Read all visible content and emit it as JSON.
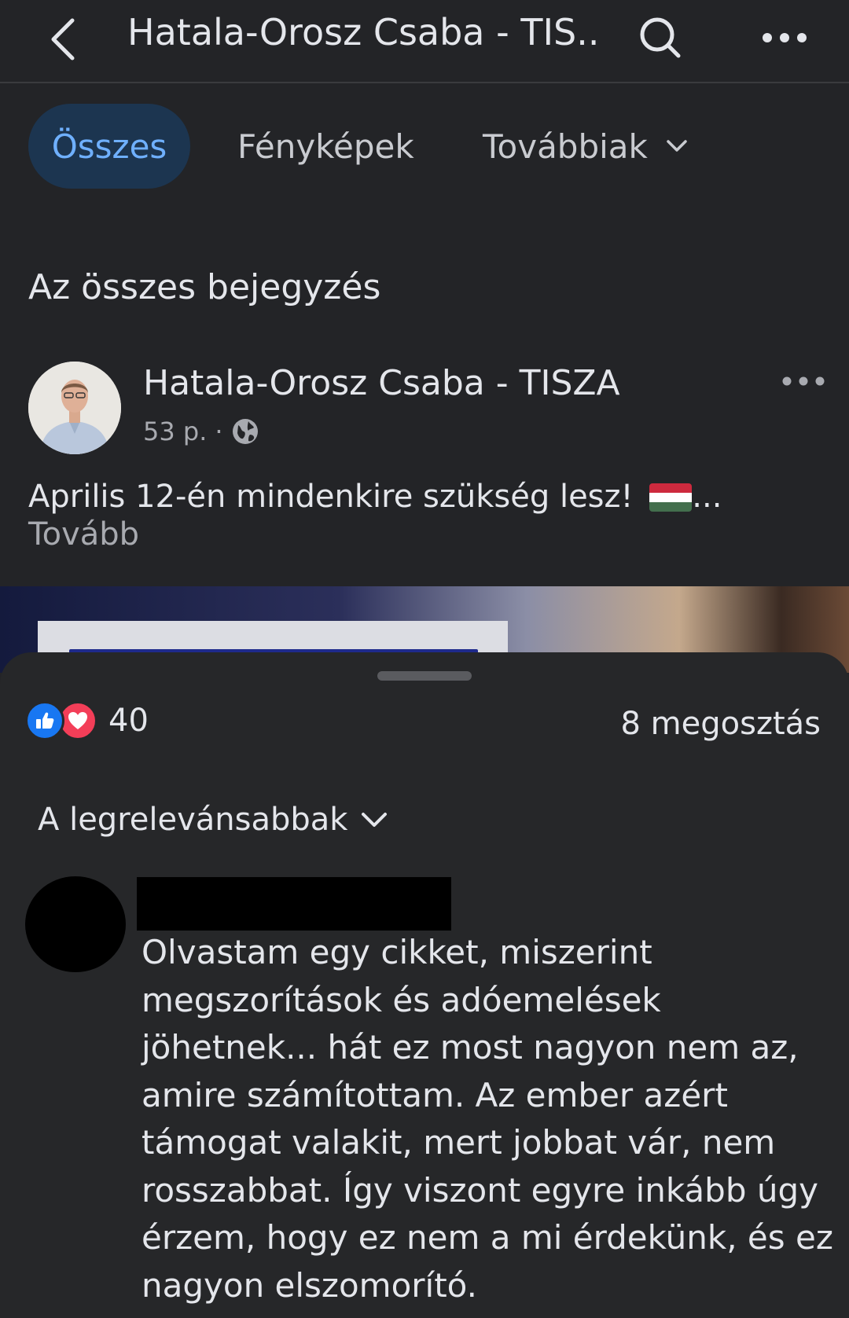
{
  "header": {
    "title": "Hatala-Orosz Csaba - TIS...",
    "back_icon": "chevron-left-icon",
    "search_icon": "search-icon",
    "more_icon": "more-horizontal-icon"
  },
  "tabs": [
    {
      "label": "Összes",
      "active": true
    },
    {
      "label": "Fényképek",
      "active": false
    },
    {
      "label": "Továbbiak",
      "active": false,
      "icon": "chevron-down-icon"
    }
  ],
  "section_title": "Az összes bejegyzés",
  "post": {
    "author": "Hatala-Orosz Csaba - TISZA",
    "time": "53 p.",
    "separator": "·",
    "privacy_icon": "globe-icon",
    "text": "Aprilis 12-én mindenkire szükség lesz!",
    "emoji": "hungarian-flag",
    "ellipsis": "...",
    "see_more": "Tovább"
  },
  "sheet": {
    "reactions": {
      "types": [
        "like",
        "love"
      ],
      "count": "40"
    },
    "shares": "8 megosztás",
    "sort_label": "A legrelevánsabbak",
    "comments": [
      {
        "author_hidden": true,
        "text": "Olvastam egy cikket, miszerint megszorítások és adóemelések jöhetnek... hát ez most nagyon nem az, amire számítottam. Az ember azért támogat valakit, mert jobbat vár, nem rosszabbat. Így viszont egyre inkább úgy érzem, hogy ez nem a mi érdekünk, és ez nagyon elszomorító."
      }
    ]
  },
  "colors": {
    "background": "#232427",
    "sheet": "#262729",
    "active_tab_bg": "#1c3550",
    "active_tab_text": "#6fb0ff",
    "like_blue": "#1877f2",
    "love_red": "#f33e58",
    "flag_red": "#cd2a3e",
    "flag_white": "#ffffff",
    "flag_green": "#436f4d"
  }
}
